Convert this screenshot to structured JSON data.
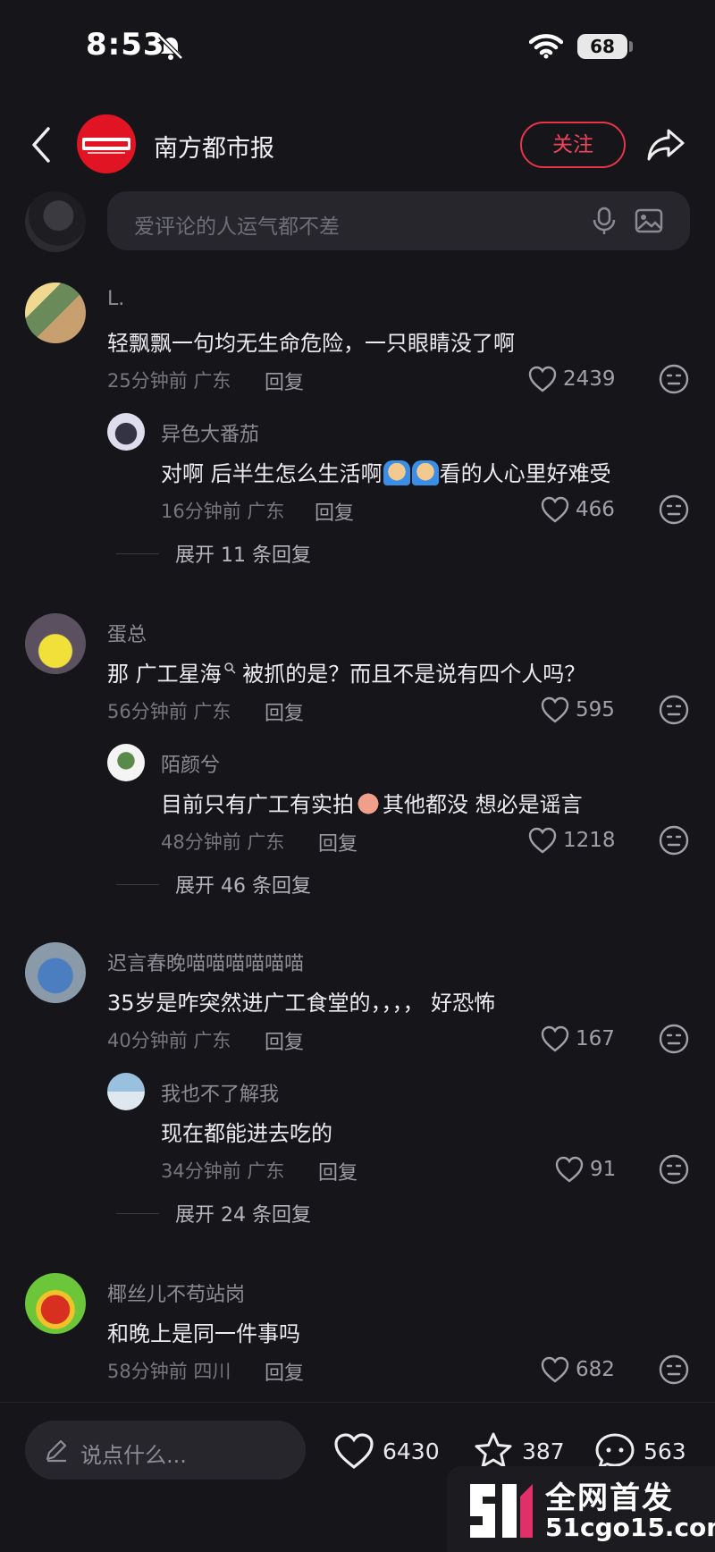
{
  "status_bar": {
    "time": "8:53",
    "battery": "68"
  },
  "header": {
    "account_name": "南方都市报",
    "follow_label": "关注"
  },
  "composer": {
    "placeholder": "爱评论的人运气都不差"
  },
  "comments": [
    {
      "name": "L.",
      "text": "轻飘飘一句均无生命危险，一只眼睛没了啊",
      "meta": "25分钟前 广东",
      "reply_label": "回复",
      "likes": "2439",
      "avatar_color": "#6b8a5a",
      "sub": {
        "name": "异色大番茄",
        "text_before": "对啊 后半生怎么生活啊",
        "text_after": "看的人心里好难受",
        "meta": "16分钟前 广东",
        "reply_label": "回复",
        "likes": "466"
      },
      "expand_label": "展开 11 条回复"
    },
    {
      "name": "蛋总",
      "text_before": "那 广工星海",
      "text_after": " 被抓的是？而且不是说有四个人吗？",
      "meta": "56分钟前 广东",
      "reply_label": "回复",
      "likes": "595",
      "avatar_color": "#f1e03a",
      "sub": {
        "name": "陌颜兮",
        "text_before": "目前只有广工有实拍",
        "text_after": "其他都没 想必是谣言",
        "meta": "48分钟前 广东",
        "reply_label": "回复",
        "likes": "1218"
      },
      "expand_label": "展开 46 条回复"
    },
    {
      "name": "迟言春晚喵喵喵喵喵喵",
      "text": "35岁是咋突然进广工食堂的，，，，  好恐怖",
      "meta": "40分钟前 广东",
      "reply_label": "回复",
      "likes": "167",
      "avatar_color": "#3d6aa8",
      "sub": {
        "name": "我也不了解我",
        "text": "现在都能进去吃的",
        "meta": "34分钟前 广东",
        "reply_label": "回复",
        "likes": "91"
      },
      "expand_label": "展开 24 条回复"
    },
    {
      "name": "椰丝儿不苟站岗",
      "text": "和晚上是同一件事吗",
      "meta": "58分钟前 四川",
      "reply_label": "回复",
      "likes": "682",
      "avatar_color": "#6cc63a"
    }
  ],
  "bottom_bar": {
    "placeholder": "说点什么...",
    "likes": "6430",
    "favorites": "387",
    "comments": "563"
  },
  "watermark": {
    "title": "全网首发",
    "url": "51cgo15.com"
  }
}
